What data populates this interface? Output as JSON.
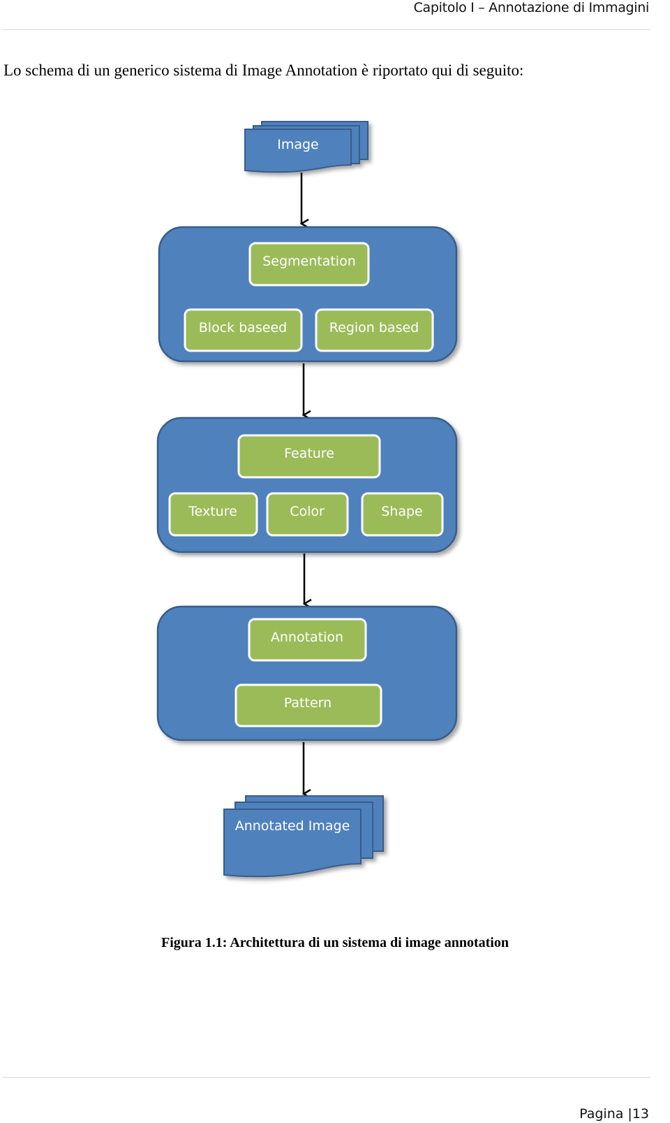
{
  "header": {
    "running_title": "Capitolo I – Annotazione di Immagini"
  },
  "body": {
    "intro": "Lo schema di un generico sistema di Image Annotation è riportato qui di seguito:"
  },
  "diagram": {
    "colors": {
      "container": "#4f81bd",
      "container_border": "#385d8a",
      "node": "#9bbb59",
      "node_border": "#ffffff",
      "arrow": "#000000"
    },
    "input": {
      "label": "Image"
    },
    "stages": [
      {
        "name": "segmentation",
        "title": "Segmentation",
        "children": [
          "Block baseed",
          "Region based"
        ]
      },
      {
        "name": "feature",
        "title": "Feature",
        "children": [
          "Texture",
          "Color",
          "Shape"
        ]
      },
      {
        "name": "annotation",
        "title": "Annotation",
        "children": [
          "Pattern"
        ]
      }
    ],
    "output": {
      "label": "Annotated Image"
    }
  },
  "figure": {
    "caption": "Figura 1.1: Architettura di un sistema di image annotation"
  },
  "footer": {
    "page_label": "Pagina |13"
  }
}
